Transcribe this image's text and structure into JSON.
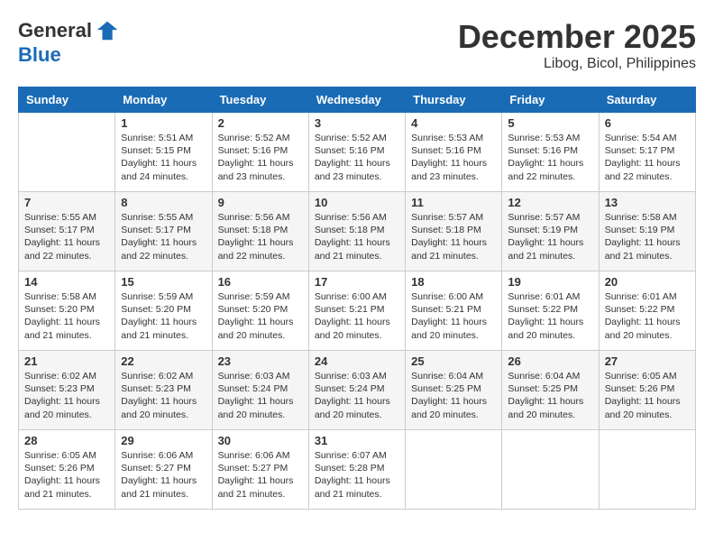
{
  "header": {
    "logo_general": "General",
    "logo_blue": "Blue",
    "month": "December 2025",
    "location": "Libog, Bicol, Philippines"
  },
  "weekdays": [
    "Sunday",
    "Monday",
    "Tuesday",
    "Wednesday",
    "Thursday",
    "Friday",
    "Saturday"
  ],
  "weeks": [
    [
      {
        "day": "",
        "sunrise": "",
        "sunset": "",
        "daylight": ""
      },
      {
        "day": "1",
        "sunrise": "Sunrise: 5:51 AM",
        "sunset": "Sunset: 5:15 PM",
        "daylight": "Daylight: 11 hours and 24 minutes."
      },
      {
        "day": "2",
        "sunrise": "Sunrise: 5:52 AM",
        "sunset": "Sunset: 5:16 PM",
        "daylight": "Daylight: 11 hours and 23 minutes."
      },
      {
        "day": "3",
        "sunrise": "Sunrise: 5:52 AM",
        "sunset": "Sunset: 5:16 PM",
        "daylight": "Daylight: 11 hours and 23 minutes."
      },
      {
        "day": "4",
        "sunrise": "Sunrise: 5:53 AM",
        "sunset": "Sunset: 5:16 PM",
        "daylight": "Daylight: 11 hours and 23 minutes."
      },
      {
        "day": "5",
        "sunrise": "Sunrise: 5:53 AM",
        "sunset": "Sunset: 5:16 PM",
        "daylight": "Daylight: 11 hours and 22 minutes."
      },
      {
        "day": "6",
        "sunrise": "Sunrise: 5:54 AM",
        "sunset": "Sunset: 5:17 PM",
        "daylight": "Daylight: 11 hours and 22 minutes."
      }
    ],
    [
      {
        "day": "7",
        "sunrise": "Sunrise: 5:55 AM",
        "sunset": "Sunset: 5:17 PM",
        "daylight": "Daylight: 11 hours and 22 minutes."
      },
      {
        "day": "8",
        "sunrise": "Sunrise: 5:55 AM",
        "sunset": "Sunset: 5:17 PM",
        "daylight": "Daylight: 11 hours and 22 minutes."
      },
      {
        "day": "9",
        "sunrise": "Sunrise: 5:56 AM",
        "sunset": "Sunset: 5:18 PM",
        "daylight": "Daylight: 11 hours and 22 minutes."
      },
      {
        "day": "10",
        "sunrise": "Sunrise: 5:56 AM",
        "sunset": "Sunset: 5:18 PM",
        "daylight": "Daylight: 11 hours and 21 minutes."
      },
      {
        "day": "11",
        "sunrise": "Sunrise: 5:57 AM",
        "sunset": "Sunset: 5:18 PM",
        "daylight": "Daylight: 11 hours and 21 minutes."
      },
      {
        "day": "12",
        "sunrise": "Sunrise: 5:57 AM",
        "sunset": "Sunset: 5:19 PM",
        "daylight": "Daylight: 11 hours and 21 minutes."
      },
      {
        "day": "13",
        "sunrise": "Sunrise: 5:58 AM",
        "sunset": "Sunset: 5:19 PM",
        "daylight": "Daylight: 11 hours and 21 minutes."
      }
    ],
    [
      {
        "day": "14",
        "sunrise": "Sunrise: 5:58 AM",
        "sunset": "Sunset: 5:20 PM",
        "daylight": "Daylight: 11 hours and 21 minutes."
      },
      {
        "day": "15",
        "sunrise": "Sunrise: 5:59 AM",
        "sunset": "Sunset: 5:20 PM",
        "daylight": "Daylight: 11 hours and 21 minutes."
      },
      {
        "day": "16",
        "sunrise": "Sunrise: 5:59 AM",
        "sunset": "Sunset: 5:20 PM",
        "daylight": "Daylight: 11 hours and 20 minutes."
      },
      {
        "day": "17",
        "sunrise": "Sunrise: 6:00 AM",
        "sunset": "Sunset: 5:21 PM",
        "daylight": "Daylight: 11 hours and 20 minutes."
      },
      {
        "day": "18",
        "sunrise": "Sunrise: 6:00 AM",
        "sunset": "Sunset: 5:21 PM",
        "daylight": "Daylight: 11 hours and 20 minutes."
      },
      {
        "day": "19",
        "sunrise": "Sunrise: 6:01 AM",
        "sunset": "Sunset: 5:22 PM",
        "daylight": "Daylight: 11 hours and 20 minutes."
      },
      {
        "day": "20",
        "sunrise": "Sunrise: 6:01 AM",
        "sunset": "Sunset: 5:22 PM",
        "daylight": "Daylight: 11 hours and 20 minutes."
      }
    ],
    [
      {
        "day": "21",
        "sunrise": "Sunrise: 6:02 AM",
        "sunset": "Sunset: 5:23 PM",
        "daylight": "Daylight: 11 hours and 20 minutes."
      },
      {
        "day": "22",
        "sunrise": "Sunrise: 6:02 AM",
        "sunset": "Sunset: 5:23 PM",
        "daylight": "Daylight: 11 hours and 20 minutes."
      },
      {
        "day": "23",
        "sunrise": "Sunrise: 6:03 AM",
        "sunset": "Sunset: 5:24 PM",
        "daylight": "Daylight: 11 hours and 20 minutes."
      },
      {
        "day": "24",
        "sunrise": "Sunrise: 6:03 AM",
        "sunset": "Sunset: 5:24 PM",
        "daylight": "Daylight: 11 hours and 20 minutes."
      },
      {
        "day": "25",
        "sunrise": "Sunrise: 6:04 AM",
        "sunset": "Sunset: 5:25 PM",
        "daylight": "Daylight: 11 hours and 20 minutes."
      },
      {
        "day": "26",
        "sunrise": "Sunrise: 6:04 AM",
        "sunset": "Sunset: 5:25 PM",
        "daylight": "Daylight: 11 hours and 20 minutes."
      },
      {
        "day": "27",
        "sunrise": "Sunrise: 6:05 AM",
        "sunset": "Sunset: 5:26 PM",
        "daylight": "Daylight: 11 hours and 20 minutes."
      }
    ],
    [
      {
        "day": "28",
        "sunrise": "Sunrise: 6:05 AM",
        "sunset": "Sunset: 5:26 PM",
        "daylight": "Daylight: 11 hours and 21 minutes."
      },
      {
        "day": "29",
        "sunrise": "Sunrise: 6:06 AM",
        "sunset": "Sunset: 5:27 PM",
        "daylight": "Daylight: 11 hours and 21 minutes."
      },
      {
        "day": "30",
        "sunrise": "Sunrise: 6:06 AM",
        "sunset": "Sunset: 5:27 PM",
        "daylight": "Daylight: 11 hours and 21 minutes."
      },
      {
        "day": "31",
        "sunrise": "Sunrise: 6:07 AM",
        "sunset": "Sunset: 5:28 PM",
        "daylight": "Daylight: 11 hours and 21 minutes."
      },
      {
        "day": "",
        "sunrise": "",
        "sunset": "",
        "daylight": ""
      },
      {
        "day": "",
        "sunrise": "",
        "sunset": "",
        "daylight": ""
      },
      {
        "day": "",
        "sunrise": "",
        "sunset": "",
        "daylight": ""
      }
    ]
  ]
}
